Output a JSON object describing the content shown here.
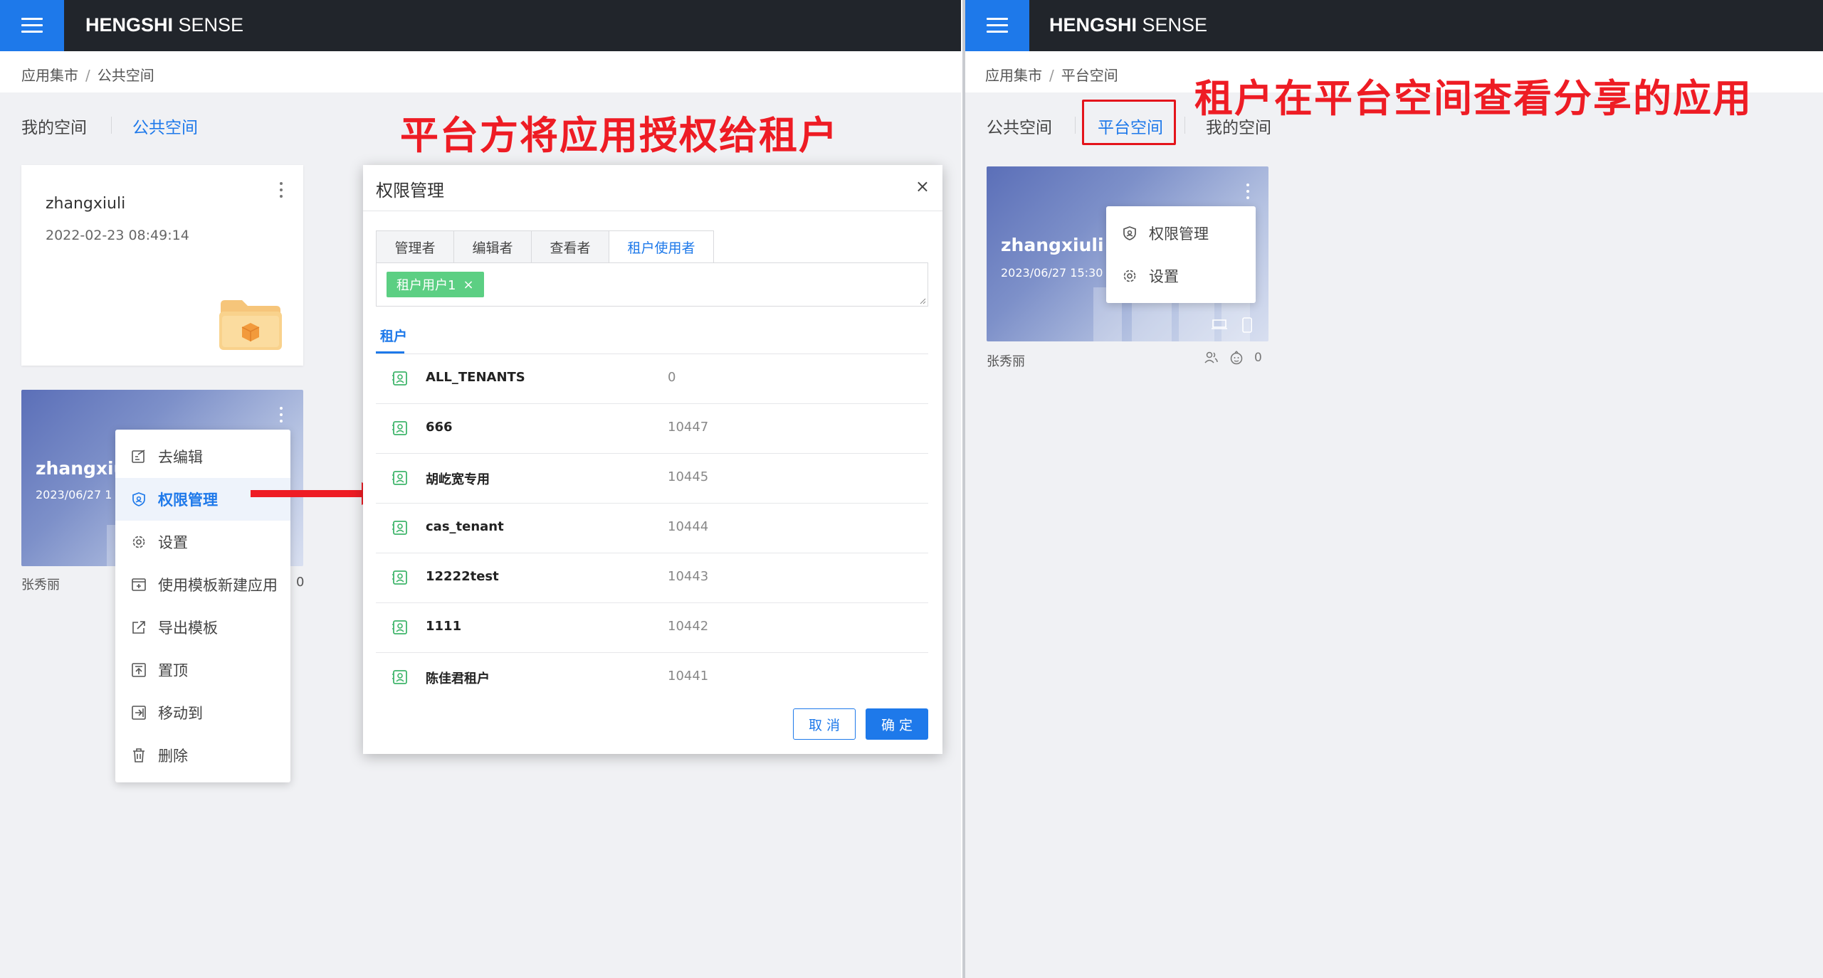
{
  "left": {
    "brand": {
      "bold": "HENGSHI",
      "rest": " SENSE"
    },
    "breadcrumb": [
      "应用集市",
      "公共空间"
    ],
    "breadcrumb_sep": "/",
    "tabs": [
      {
        "label": "我的空间",
        "active": false
      },
      {
        "label": "公共空间",
        "active": true
      }
    ],
    "annotation": "平台方将应用授权给租户",
    "folder_card": {
      "title": "zhangxiuli",
      "date": "2022-02-23 08:49:14"
    },
    "app_card": {
      "title": "zhangxiu",
      "date": "2023/06/27 1",
      "owner": "张秀丽",
      "count": "0"
    },
    "context_menu": [
      {
        "label": "去编辑",
        "icon": "edit-icon",
        "active": false
      },
      {
        "label": "权限管理",
        "icon": "shield-icon",
        "active": true
      },
      {
        "label": "设置",
        "icon": "gear-icon",
        "active": false
      },
      {
        "label": "使用模板新建应用",
        "icon": "template-new-icon",
        "active": false
      },
      {
        "label": "导出模板",
        "icon": "export-icon",
        "active": false
      },
      {
        "label": "置顶",
        "icon": "pin-top-icon",
        "active": false
      },
      {
        "label": "移动到",
        "icon": "move-icon",
        "active": false
      },
      {
        "label": "删除",
        "icon": "trash-icon",
        "active": false
      }
    ]
  },
  "dialog": {
    "title": "权限管理",
    "close": "×",
    "role_tabs": [
      {
        "label": "管理者",
        "active": false
      },
      {
        "label": "编辑者",
        "active": false
      },
      {
        "label": "查看者",
        "active": false
      },
      {
        "label": "租户使用者",
        "active": true
      }
    ],
    "selected_chip": "租户用户1",
    "chip_remove": "×",
    "sub_tab": "租户",
    "tenants": [
      {
        "name": "ALL_TENANTS",
        "id": "0"
      },
      {
        "name": "666",
        "id": "10447"
      },
      {
        "name": "胡屹宽专用",
        "id": "10445"
      },
      {
        "name": "cas_tenant",
        "id": "10444"
      },
      {
        "name": "12222test",
        "id": "10443"
      },
      {
        "name": "1111",
        "id": "10442"
      },
      {
        "name": "陈佳君租户",
        "id": "10441"
      }
    ],
    "cancel_label": "取 消",
    "ok_label": "确 定"
  },
  "right": {
    "brand": {
      "bold": "HENGSHI",
      "rest": " SENSE"
    },
    "breadcrumb": [
      "应用集市",
      "平台空间"
    ],
    "breadcrumb_sep": "/",
    "annotation": "租户在平台空间查看分享的应用",
    "tabs": [
      {
        "label": "公共空间",
        "active": false
      },
      {
        "label": "平台空间",
        "active": true
      },
      {
        "label": "我的空间",
        "active": false
      }
    ],
    "app_card": {
      "title": "zhangxiuli",
      "date": "2023/06/27 15:30",
      "owner": "张秀丽",
      "count": "0"
    },
    "context_menu": [
      {
        "label": "权限管理",
        "icon": "shield-icon"
      },
      {
        "label": "设置",
        "icon": "gear-icon"
      }
    ]
  },
  "colors": {
    "accent": "#1e79ea",
    "topbar": "#21252b",
    "annotation": "#ee1c24",
    "chip": "#5ccf83"
  }
}
